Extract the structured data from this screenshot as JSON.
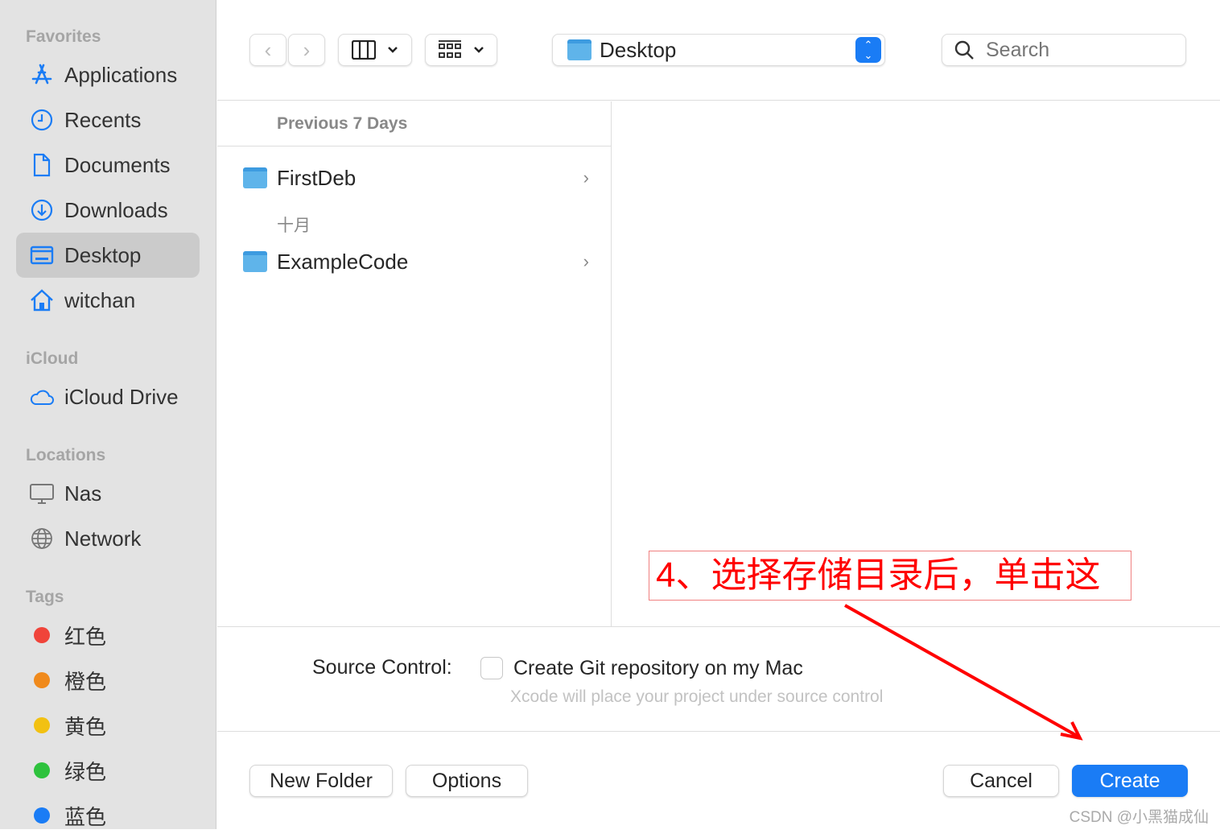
{
  "sidebar": {
    "favorites_label": "Favorites",
    "favorites": [
      {
        "label": "Applications",
        "icon": "applications-icon"
      },
      {
        "label": "Recents",
        "icon": "clock-icon"
      },
      {
        "label": "Documents",
        "icon": "document-icon"
      },
      {
        "label": "Downloads",
        "icon": "download-icon"
      },
      {
        "label": "Desktop",
        "icon": "desktop-icon",
        "selected": true
      },
      {
        "label": "witchan",
        "icon": "home-icon"
      }
    ],
    "icloud_label": "iCloud",
    "icloud": [
      {
        "label": "iCloud Drive",
        "icon": "cloud-icon"
      }
    ],
    "locations_label": "Locations",
    "locations": [
      {
        "label": "Nas",
        "icon": "monitor-icon"
      },
      {
        "label": "Network",
        "icon": "globe-icon"
      }
    ],
    "tags_label": "Tags",
    "tags": [
      {
        "label": "红色",
        "color": "#f0443a"
      },
      {
        "label": "橙色",
        "color": "#f08a1c"
      },
      {
        "label": "黄色",
        "color": "#f2c112"
      },
      {
        "label": "绿色",
        "color": "#2ec23d"
      },
      {
        "label": "蓝色",
        "color": "#1a7cf5"
      }
    ]
  },
  "toolbar": {
    "location": "Desktop",
    "search_placeholder": "Search"
  },
  "browser": {
    "group1": "Previous 7 Days",
    "items1": [
      {
        "name": "FirstDeb"
      }
    ],
    "group2": "十月",
    "items2": [
      {
        "name": "ExampleCode"
      }
    ]
  },
  "source_control": {
    "label": "Source Control:",
    "checkbox_label": "Create Git repository on my Mac",
    "checked": false,
    "hint": "Xcode will place your project under source control"
  },
  "annotation": {
    "text": "4、选择存储目录后，单击这"
  },
  "buttons": {
    "new_folder": "New Folder",
    "options": "Options",
    "cancel": "Cancel",
    "create": "Create"
  },
  "watermark": "CSDN @小黑猫成仙",
  "colors": {
    "accent": "#1a7cf5",
    "annotation": "#ff0000"
  }
}
